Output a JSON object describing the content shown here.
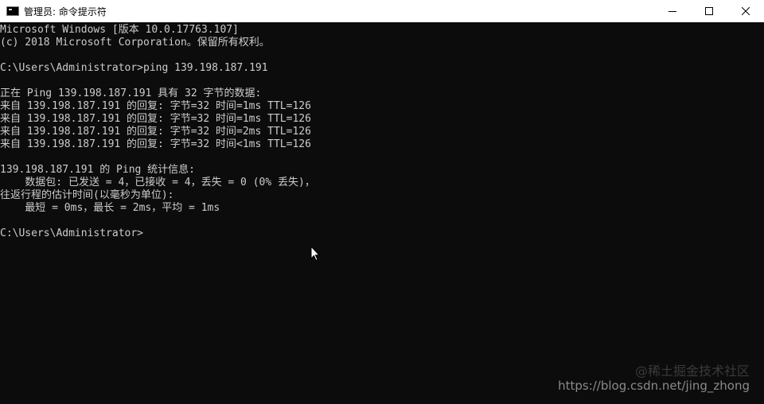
{
  "window": {
    "title": "管理员: 命令提示符",
    "icon": "cmd-icon"
  },
  "caption": {
    "minimize_icon": "minimize-icon",
    "maximize_icon": "maximize-icon",
    "close_icon": "close-icon"
  },
  "console": {
    "lines": [
      "Microsoft Windows [版本 10.0.17763.107]",
      "(c) 2018 Microsoft Corporation。保留所有权利。",
      "",
      "C:\\Users\\Administrator>ping 139.198.187.191",
      "",
      "正在 Ping 139.198.187.191 具有 32 字节的数据:",
      "来自 139.198.187.191 的回复: 字节=32 时间=1ms TTL=126",
      "来自 139.198.187.191 的回复: 字节=32 时间=1ms TTL=126",
      "来自 139.198.187.191 的回复: 字节=32 时间=2ms TTL=126",
      "来自 139.198.187.191 的回复: 字节=32 时间<1ms TTL=126",
      "",
      "139.198.187.191 的 Ping 统计信息:",
      "    数据包: 已发送 = 4，已接收 = 4，丢失 = 0 (0% 丢失)，",
      "往返行程的估计时间(以毫秒为单位):",
      "    最短 = 0ms，最长 = 2ms，平均 = 1ms",
      "",
      "C:\\Users\\Administrator>"
    ]
  },
  "watermark": {
    "site": "@稀土掘金技术社区",
    "url": "https://blog.csdn.net/jing_zhong"
  },
  "colors": {
    "console_bg": "#0c0c0c",
    "console_fg": "#cccccc",
    "titlebar_bg": "#ffffff"
  }
}
